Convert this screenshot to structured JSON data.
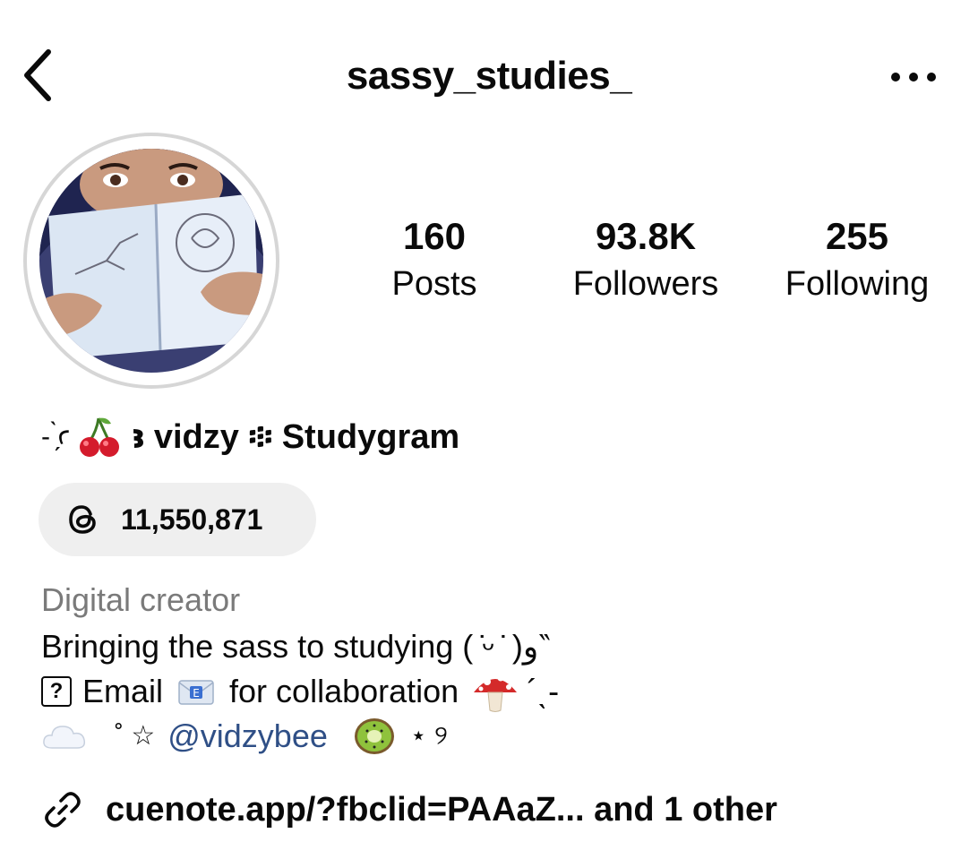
{
  "header": {
    "username": "sassy_studies_",
    "back_icon": "chevron-left-icon",
    "more_icon": "more-horizontal-icon"
  },
  "avatar": {
    "description_icon": "profile-photo"
  },
  "stats": {
    "posts": {
      "value": "160",
      "label": "Posts"
    },
    "followers": {
      "value": "93.8K",
      "label": "Followers"
    },
    "following": {
      "value": "255",
      "label": "Following"
    }
  },
  "profile": {
    "display_name_prefix": "- ̗̀ꜥ",
    "display_name_suffix": "ꜣ vidzy ፨ Studygram",
    "cherry_icon": "cherry-icon"
  },
  "threads": {
    "count": "11,550,871",
    "icon": "threads-icon"
  },
  "bio": {
    "category": "Digital creator",
    "line1": "Bringing the sass to studying   ( ̇ᵕ ̇ )و‶",
    "line2_text": "Email",
    "line2_icon": "envelope-icon",
    "line2_rest": "for collaboration",
    "line2_end": "´ˎ-",
    "line2_qmark": "?",
    "line3_deco": "˚ ☆",
    "line3_mention": "@vidzybee",
    "line3_end": "⋆ ୨"
  },
  "link": {
    "text": "cuenote.app/?fbclid=PAAaZ...  and 1 other",
    "icon": "link-icon"
  },
  "colors": {
    "mention": "#2f4f86",
    "category": "#7a7a7a",
    "pill_bg": "#efefef"
  }
}
